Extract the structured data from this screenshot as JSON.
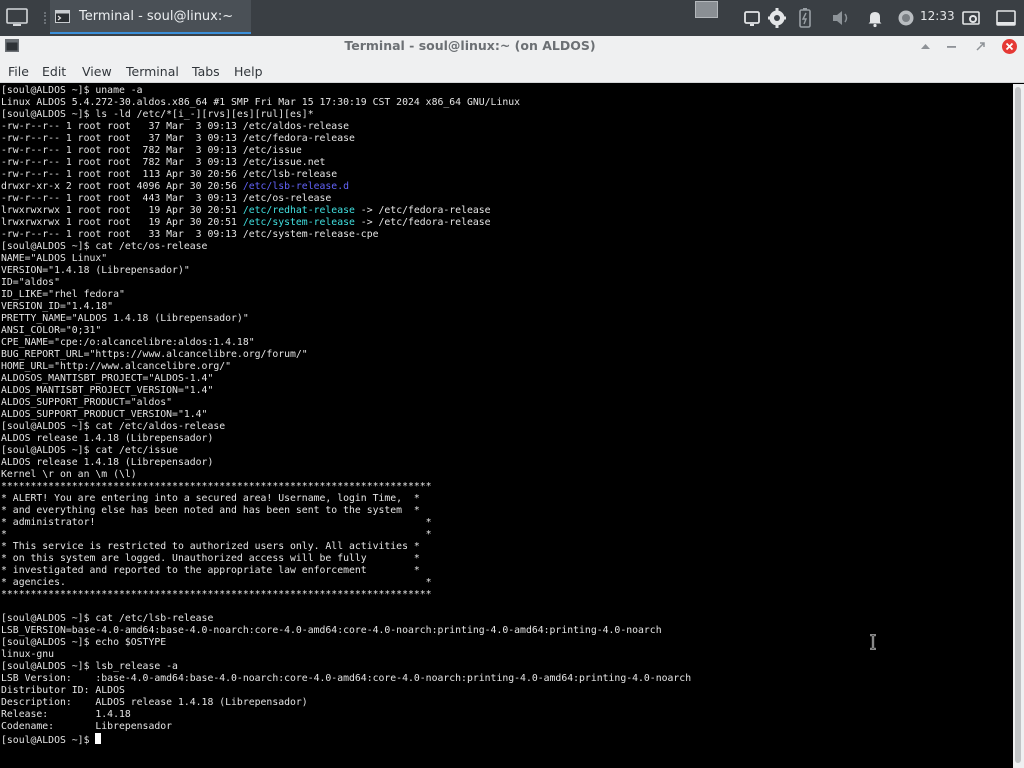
{
  "taskbar": {
    "task_label": "Terminal - soul@linux:~",
    "clock": "12:33"
  },
  "window": {
    "title": "Terminal - soul@linux:~ (on ALDOS)"
  },
  "menu": {
    "file": "File",
    "edit": "Edit",
    "view": "View",
    "terminal": "Terminal",
    "tabs": "Tabs",
    "help": "Help"
  },
  "colors": {
    "taskbar_bg": "#3a3f44",
    "window_chrome": "#eff0f1",
    "task_underline": "#3b8fd9",
    "close_red": "#e53935",
    "dir_blue": "#6363f8",
    "link_cyan": "#41e0e0"
  },
  "terminal": {
    "lines": [
      {
        "t": "[soul@ALDOS ~]$ uname -a"
      },
      {
        "t": "Linux ALDOS 5.4.272-30.aldos.x86_64 #1 SMP Fri Mar 15 17:30:19 CST 2024 x86_64 GNU/Linux"
      },
      {
        "t": "[soul@ALDOS ~]$ ls -ld /etc/*[i_-][rvs][es][rul][es]*"
      },
      {
        "t": "-rw-r--r-- 1 root root   37 Mar  3 09:13 /etc/aldos-release"
      },
      {
        "t": "-rw-r--r-- 1 root root   37 Mar  3 09:13 /etc/fedora-release"
      },
      {
        "t": "-rw-r--r-- 1 root root  782 Mar  3 09:13 /etc/issue"
      },
      {
        "t": "-rw-r--r-- 1 root root  782 Mar  3 09:13 /etc/issue.net"
      },
      {
        "t": "-rw-r--r-- 1 root root  113 Apr 30 20:56 /etc/lsb-release"
      },
      {
        "t": "drwxr-xr-x 2 root root 4096 Apr 30 20:56 ",
        "c": "/etc/lsb-release.d",
        "cc": "blue"
      },
      {
        "t": "-rw-r--r-- 1 root root  443 Mar  3 09:13 /etc/os-release"
      },
      {
        "t": "lrwxrwxrwx 1 root root   19 Apr 30 20:51 ",
        "c": "/etc/redhat-release",
        "cc": "cyan",
        "r": " -> /etc/fedora-release"
      },
      {
        "t": "lrwxrwxrwx 1 root root   19 Apr 30 20:51 ",
        "c": "/etc/system-release",
        "cc": "cyan",
        "r": " -> /etc/fedora-release"
      },
      {
        "t": "-rw-r--r-- 1 root root   33 Mar  3 09:13 /etc/system-release-cpe"
      },
      {
        "t": "[soul@ALDOS ~]$ cat /etc/os-release"
      },
      {
        "t": "NAME=\"ALDOS Linux\""
      },
      {
        "t": "VERSION=\"1.4.18 (Librepensador)\""
      },
      {
        "t": "ID=\"aldos\""
      },
      {
        "t": "ID_LIKE=\"rhel fedora\""
      },
      {
        "t": "VERSION_ID=\"1.4.18\""
      },
      {
        "t": "PRETTY_NAME=\"ALDOS 1.4.18 (Librepensador)\""
      },
      {
        "t": "ANSI_COLOR=\"0;31\""
      },
      {
        "t": "CPE_NAME=\"cpe:/o:alcancelibre:aldos:1.4.18\""
      },
      {
        "t": "BUG_REPORT_URL=\"https://www.alcancelibre.org/forum/\""
      },
      {
        "t": "HOME_URL=\"http://www.alcancelibre.org/\""
      },
      {
        "t": "ALDOSOS_MANTISBT_PROJECT=\"ALDOS-1.4\""
      },
      {
        "t": "ALDOS_MANTISBT_PROJECT_VERSION=\"1.4\""
      },
      {
        "t": "ALDOS_SUPPORT_PRODUCT=\"aldos\""
      },
      {
        "t": "ALDOS_SUPPORT_PRODUCT_VERSION=\"1.4\""
      },
      {
        "t": "[soul@ALDOS ~]$ cat /etc/aldos-release"
      },
      {
        "t": "ALDOS release 1.4.18 (Librepensador)"
      },
      {
        "t": "[soul@ALDOS ~]$ cat /etc/issue"
      },
      {
        "t": "ALDOS release 1.4.18 (Librepensador)"
      },
      {
        "t": "Kernel \\r on an \\m (\\l)"
      },
      {
        "t": "*************************************************************************"
      },
      {
        "t": "* ALERT! You are entering into a secured area! Username, login Time,  *"
      },
      {
        "t": "* and everything else has been noted and has been sent to the system  *"
      },
      {
        "t": "* administrator!                                                        *"
      },
      {
        "t": "*                                                                       *"
      },
      {
        "t": "* This service is restricted to authorized users only. All activities *"
      },
      {
        "t": "* on this system are logged. Unauthorized access will be fully        *"
      },
      {
        "t": "* investigated and reported to the appropriate law enforcement        *"
      },
      {
        "t": "* agencies.                                                             *"
      },
      {
        "t": "*************************************************************************"
      },
      {
        "t": ""
      },
      {
        "t": "[soul@ALDOS ~]$ cat /etc/lsb-release"
      },
      {
        "t": "LSB_VERSION=base-4.0-amd64:base-4.0-noarch:core-4.0-amd64:core-4.0-noarch:printing-4.0-amd64:printing-4.0-noarch"
      },
      {
        "t": "[soul@ALDOS ~]$ echo $OSTYPE"
      },
      {
        "t": "linux-gnu"
      },
      {
        "t": "[soul@ALDOS ~]$ lsb_release -a"
      },
      {
        "t": "LSB Version:    :base-4.0-amd64:base-4.0-noarch:core-4.0-amd64:core-4.0-noarch:printing-4.0-amd64:printing-4.0-noarch"
      },
      {
        "t": "Distributor ID: ALDOS"
      },
      {
        "t": "Description:    ALDOS release 1.4.18 (Librepensador)"
      },
      {
        "t": "Release:        1.4.18"
      },
      {
        "t": "Codename:       Librepensador"
      },
      {
        "t": "[soul@ALDOS ~]$ ",
        "cursor": true
      }
    ]
  }
}
